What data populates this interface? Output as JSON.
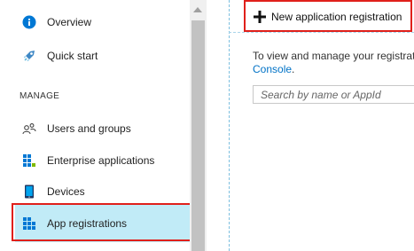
{
  "sidebar": {
    "items": [
      {
        "label": "Overview",
        "icon": "info-icon"
      },
      {
        "label": "Quick start",
        "icon": "rocket-icon"
      }
    ],
    "section_label": "MANAGE",
    "manage_items": [
      {
        "label": "Users and groups",
        "icon": "users-icon"
      },
      {
        "label": "Enterprise applications",
        "icon": "apps-grid-icon"
      },
      {
        "label": "Devices",
        "icon": "device-icon"
      },
      {
        "label": "App registrations",
        "icon": "app-registrations-icon",
        "active": true
      }
    ]
  },
  "toolbar": {
    "new_registration_label": "New application registration"
  },
  "main": {
    "info_line1": "To view and manage your registrati",
    "info_link": "Console",
    "info_period": "."
  },
  "search": {
    "placeholder": "Search by name or AppId"
  },
  "colors": {
    "highlight": "#e0201b",
    "active_bg": "#c1ebf7",
    "link": "#0072c6",
    "accent_blue": "#0078d4"
  }
}
